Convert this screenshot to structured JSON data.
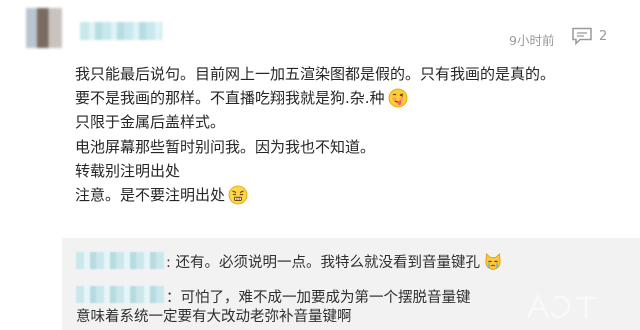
{
  "comment": {
    "time": "9小时前",
    "reply_count": "2",
    "lines": [
      "我只能最后说句。目前网上一加五渲染图都是假的。只有我画的是真的。",
      "要不是我画的那样。不直播吃翔我就是狗.杂.种",
      "只限于金属后盖样式。",
      "电池屏幕那些暂时别问我。因为我也不知道。",
      "转载别注明出处",
      "注意。是不要注明出处"
    ]
  },
  "replies": [
    {
      "text": ": 还有。必须说明一点。我特么就没看到音量键孔"
    },
    {
      "text_line1": "：可怕了，难不成一加要成为第一个摆脱音量键",
      "text_line2": "意味着系统一定要有大改动老弥补音量键啊"
    }
  ],
  "icons": {
    "comment": "comment-bubble-icon",
    "emoji_smile": "tongue-out-emoji-icon",
    "emoji_angry": "frustrated-emoji-icon",
    "emoji_cry": "crying-cat-emoji-icon",
    "watermark": "watermark-logo-icon"
  },
  "colors": {
    "meta_gray": "#9a9a9a",
    "reply_bg": "#f2f2f2",
    "text": "#262626"
  }
}
